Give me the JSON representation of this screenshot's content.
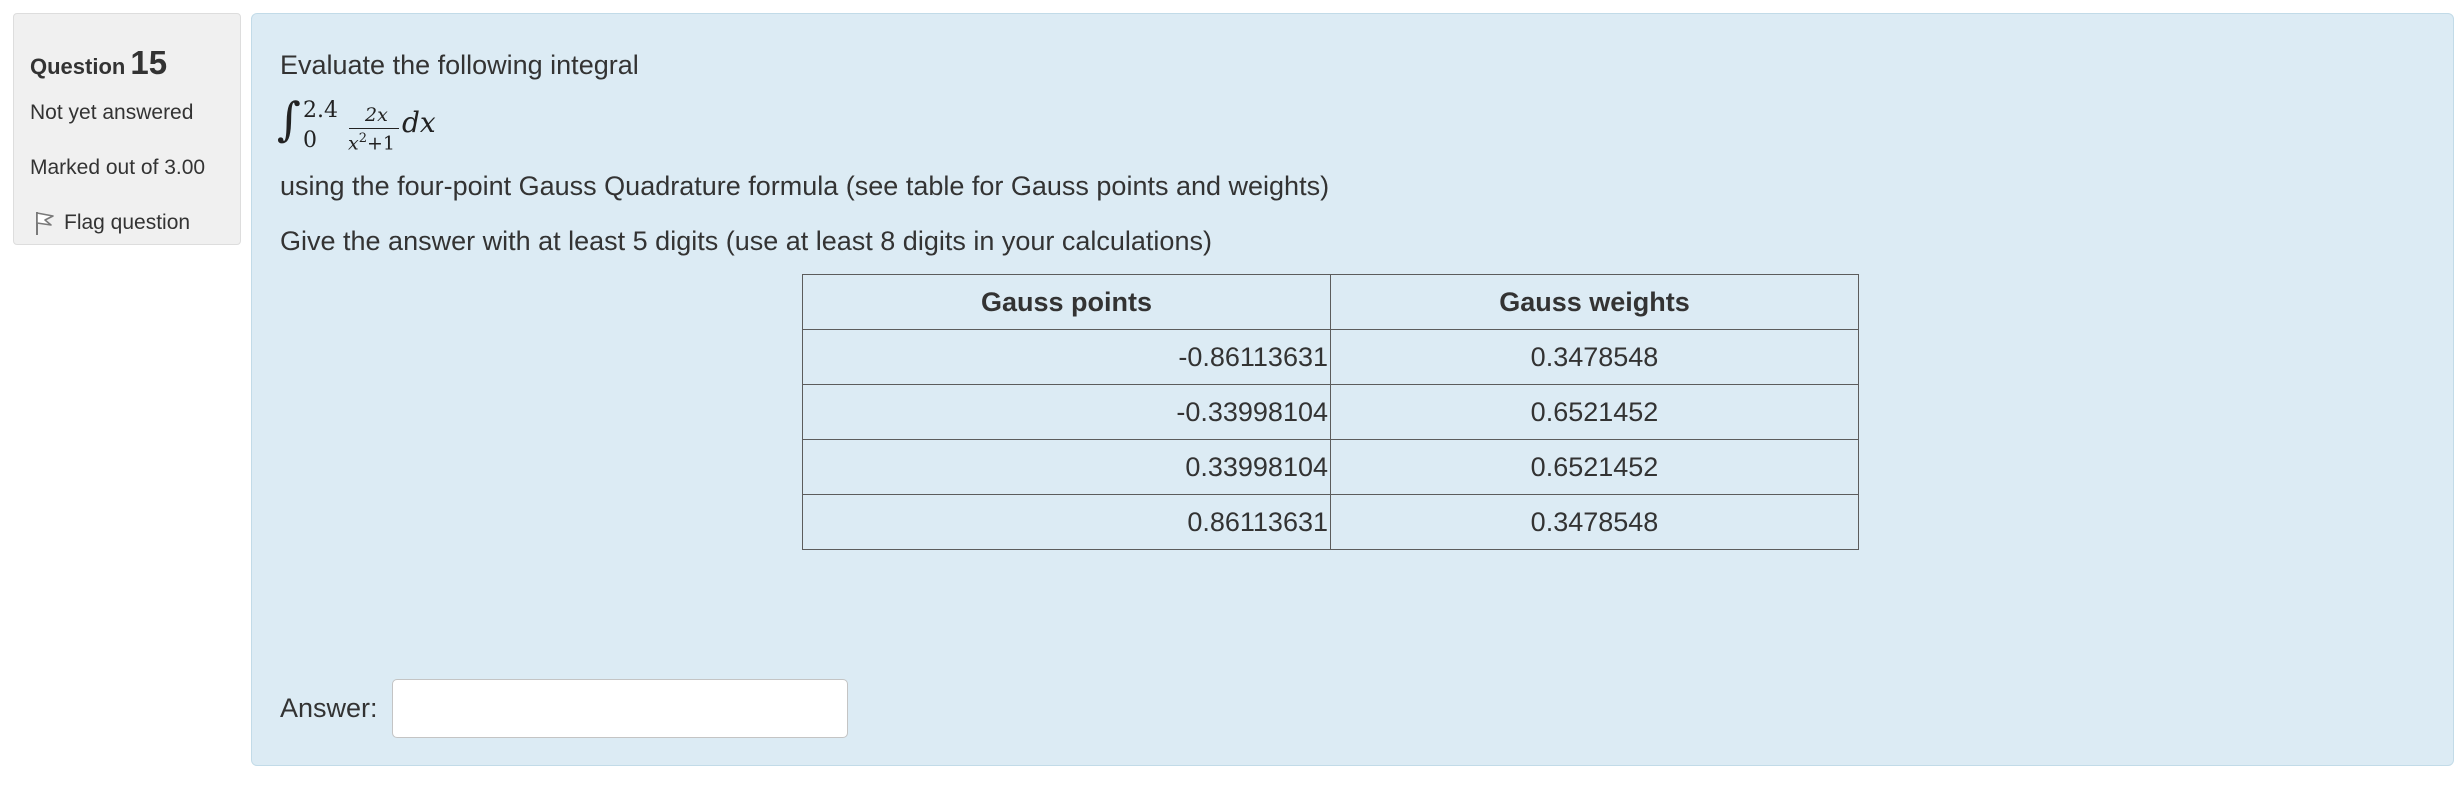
{
  "info": {
    "question_label": "Question",
    "question_number": "15",
    "state": "Not yet answered",
    "grade": "Marked out of 3.00",
    "flag_label": "Flag question",
    "flag_icon": "flag-icon"
  },
  "question": {
    "intro": "Evaluate the following integral",
    "formula": {
      "integral_sign": "∫",
      "upper_limit": "2.4",
      "lower_limit": "0",
      "numerator": "2x",
      "denominator_var": "x",
      "denominator_exp": "2",
      "denominator_rest": "+1",
      "differential": "dx"
    },
    "method": "using the four-point Gauss Quadrature formula (see table for Gauss points and weights)",
    "instruction": "Give the answer with at least 5 digits (use at least 8 digits in your calculations)"
  },
  "table": {
    "headers": [
      "Gauss points",
      "Gauss weights"
    ],
    "rows": [
      [
        "-0.86113631",
        "0.3478548"
      ],
      [
        "-0.33998104",
        "0.6521452"
      ],
      [
        "0.33998104",
        "0.6521452"
      ],
      [
        "0.86113631",
        "0.3478548"
      ]
    ]
  },
  "answer": {
    "label": "Answer:",
    "value": ""
  },
  "colors": {
    "content_bg": "#dcebf4",
    "info_bg": "#f0f0f0",
    "text": "#333333"
  }
}
